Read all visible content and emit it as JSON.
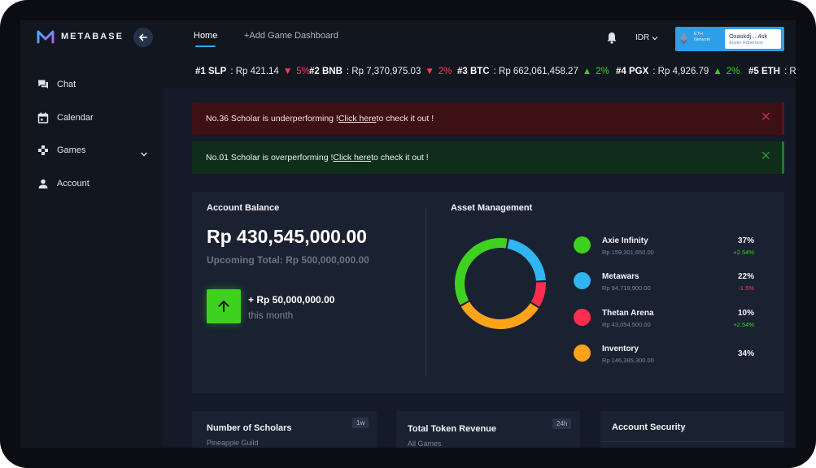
{
  "app": {
    "brand": "METABASE",
    "back_icon": "arrow-left-icon"
  },
  "nav": {
    "tabs": [
      {
        "label": "Home",
        "active": true
      },
      {
        "label": "+Add Game Dashboard",
        "active": false
      }
    ]
  },
  "header": {
    "currency": "IDR",
    "wallet": {
      "network_line1": "ETH",
      "network_line2": "Network",
      "address": "Oxaskdj....4sk",
      "user": "Austin Robertson"
    }
  },
  "sidebar": {
    "items": [
      {
        "label": "Chat",
        "icon": "chat-icon"
      },
      {
        "label": "Calendar",
        "icon": "calendar-icon"
      },
      {
        "label": "Games",
        "icon": "gamepad-icon"
      },
      {
        "label": "Account",
        "icon": "user-icon"
      }
    ]
  },
  "ticker": [
    {
      "rank": "#1 SLP",
      "price": ": Rp 421.14",
      "change": "5%",
      "dir": "down"
    },
    {
      "rank": "#2 BNB",
      "price": ": Rp 7,370,975.03",
      "change": "2%",
      "dir": "down"
    },
    {
      "rank": "#3 BTC",
      "price": ": Rp 662,061,458.27",
      "change": "2%",
      "dir": "up"
    },
    {
      "rank": "#4 PGX",
      "price": ": Rp 4,926.79",
      "change": "2%",
      "dir": "up"
    },
    {
      "rank": "#5 ETH",
      "price": ": Rp",
      "change": "",
      "dir": "none"
    }
  ],
  "alerts": [
    {
      "prefix": "No.36 Scholar is underperforming !",
      "link": " Click here",
      "suffix": " to check it out !"
    },
    {
      "prefix": "No.01 Scholar is overperforming !",
      "link": " Click here",
      "suffix": " to check it out !"
    }
  ],
  "balance": {
    "title": "Account Balance",
    "amount": "Rp 430,545,000.00",
    "upcoming": "Upcoming Total: Rp 500,000,000.00",
    "increase": "+ Rp 50,000,000.00",
    "period": "this month"
  },
  "assets": {
    "title": "Asset Management",
    "items": [
      {
        "name": "Axie Infinity",
        "value": "Rp 159,301,650.00",
        "pct": "37%",
        "change": "+2.54%",
        "dir": "up",
        "color": "#3fd11f",
        "share": 37
      },
      {
        "name": "Metawars",
        "value": "Rp 94,719,900.00",
        "pct": "22%",
        "change": "-1.5%",
        "dir": "down",
        "color": "#2fb5ef",
        "share": 22
      },
      {
        "name": "Thetan Arena",
        "value": "Rp 43,054,500.00",
        "pct": "10%",
        "change": "+2.54%",
        "dir": "up",
        "color": "#ff2d4f",
        "share": 10
      },
      {
        "name": "Inventory",
        "value": "Rp 146,385,300.00",
        "pct": "34%",
        "change": "",
        "dir": "none",
        "color": "#ffa31a",
        "share": 34
      }
    ]
  },
  "cards": {
    "scholars": {
      "title": "Number of Scholars",
      "sub": "Pineapple Guild",
      "badge": "1w"
    },
    "revenue": {
      "title": "Total Token Revenue",
      "sub": "All Games",
      "badge": "24h"
    },
    "security": {
      "title": "Account Security"
    }
  }
}
